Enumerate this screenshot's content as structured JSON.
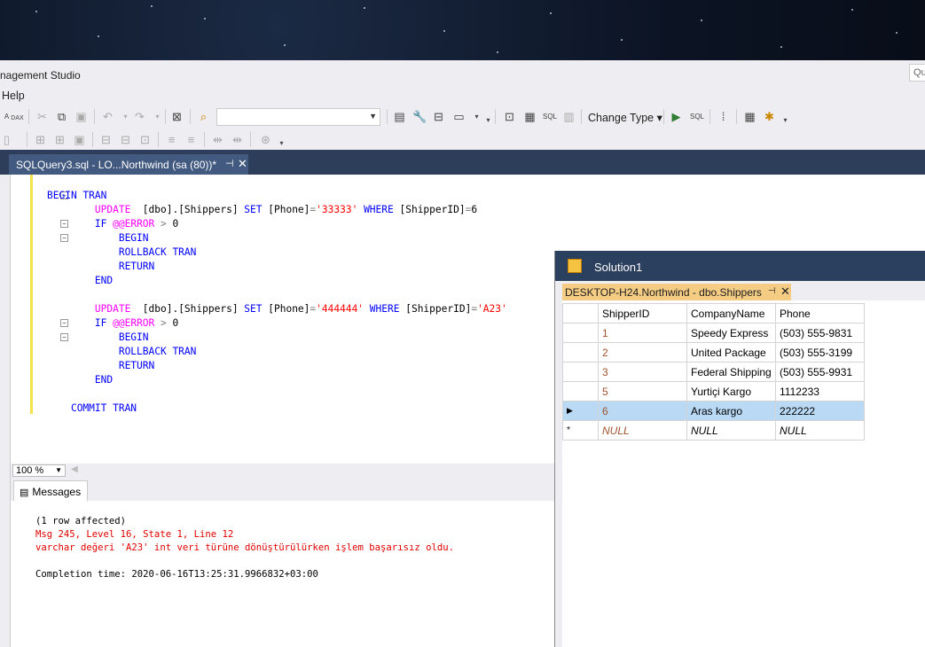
{
  "window": {
    "title_fragment": "nagement Studio",
    "quick_launch_placeholder": "Qu"
  },
  "menu": {
    "help": "Help"
  },
  "toolbar": {
    "change_type_label": "Change Type",
    "sql_label": "SQL",
    "sql_label2": "SQL",
    "dax_label": "DAX"
  },
  "editor_tab": {
    "title": "SQLQuery3.sql - LO...Northwind (sa (80))*",
    "pin": "⊣",
    "close": "✕"
  },
  "zoom": {
    "value": "100 %"
  },
  "results": {
    "tab_label": "Messages",
    "lines": [
      {
        "text": "(1 row affected)",
        "kind": "normal"
      },
      {
        "text": "Msg 245, Level 16, State 1, Line 12",
        "kind": "error"
      },
      {
        "text": "varchar değeri 'A23' int veri türüne dönüştürülürken işlem başarısız oldu.",
        "kind": "error"
      },
      {
        "text": "",
        "kind": "normal"
      },
      {
        "text": "Completion time: 2020-06-16T13:25:31.9966832+03:00",
        "kind": "normal"
      }
    ]
  },
  "solution": {
    "title": "Solution1"
  },
  "table_tab": {
    "title": "DESKTOP-H24.Northwind - dbo.Shippers",
    "pin": "⊣",
    "close": "✕"
  },
  "grid": {
    "columns": [
      "ShipperID",
      "CompanyName",
      "Phone"
    ],
    "rows": [
      {
        "marker": "",
        "id": "1",
        "company": "Speedy Express",
        "phone": "(503) 555-9831"
      },
      {
        "marker": "",
        "id": "2",
        "company": "United Package",
        "phone": "(503) 555-3199"
      },
      {
        "marker": "",
        "id": "3",
        "company": "Federal Shipping",
        "phone": "(503) 555-9931"
      },
      {
        "marker": "",
        "id": "5",
        "company": "Yurtiçi Kargo",
        "phone": "1112233"
      },
      {
        "marker": "▶",
        "id": "6",
        "company": "Aras kargo",
        "phone": "222222"
      }
    ],
    "new_row": {
      "marker": "*",
      "id": "NULL",
      "company": "NULL",
      "phone": "NULL"
    }
  }
}
